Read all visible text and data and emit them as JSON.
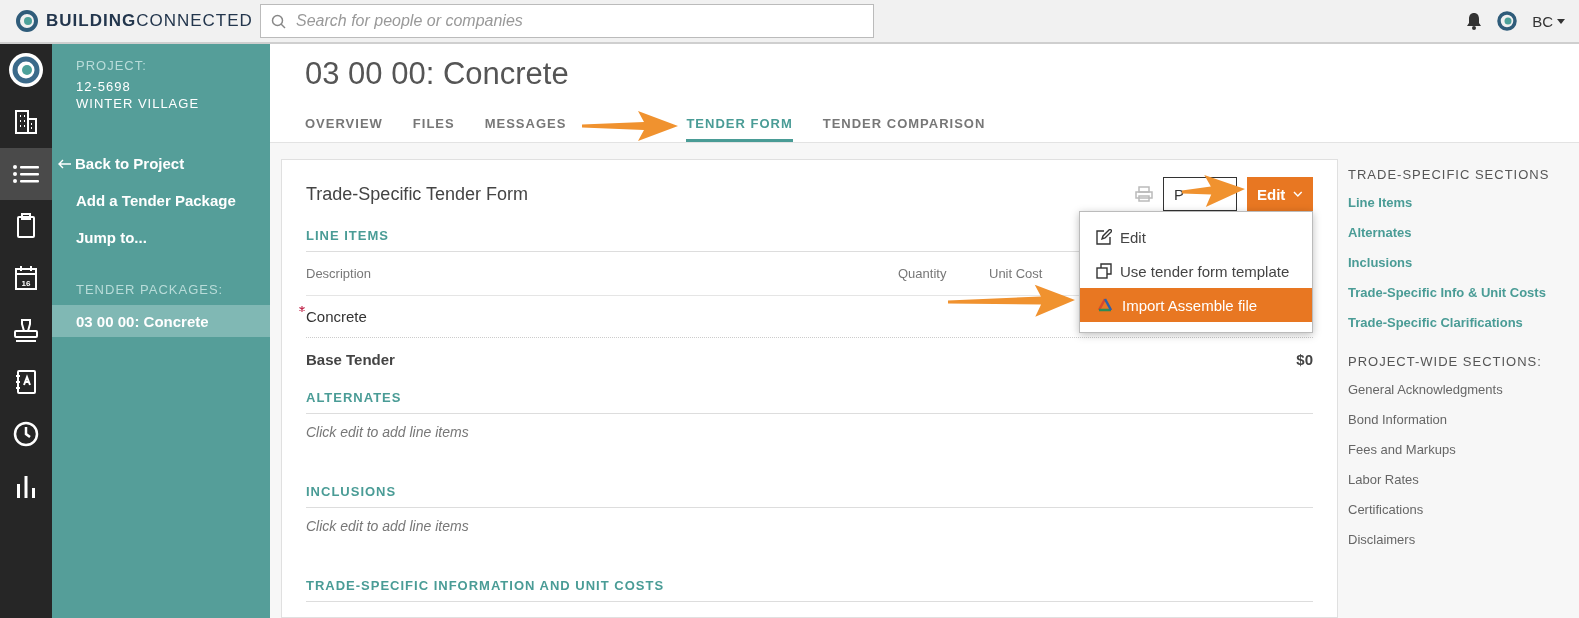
{
  "topbar": {
    "logo": {
      "bold": "BUILDING",
      "light": "CONNECTED"
    },
    "search": {
      "placeholder": "Search for people or companies"
    },
    "user": "BC"
  },
  "rail": [
    {
      "kind": "logo",
      "selected": false
    },
    {
      "kind": "building",
      "selected": false
    },
    {
      "kind": "list",
      "selected": true
    },
    {
      "kind": "clipboard",
      "selected": false
    },
    {
      "kind": "calendar",
      "selected": false,
      "label": "16"
    },
    {
      "kind": "stamp",
      "selected": false
    },
    {
      "kind": "book",
      "selected": false
    },
    {
      "kind": "clock",
      "selected": false
    },
    {
      "kind": "chart",
      "selected": false
    }
  ],
  "sidebar": {
    "project_label": "PROJECT:",
    "project_number": "12-5698",
    "project_name": "WINTER VILLAGE",
    "links": [
      {
        "label": "Back to Project",
        "back": true
      },
      {
        "label": "Add a Tender Package",
        "back": false
      },
      {
        "label": "Jump to...",
        "back": false
      }
    ],
    "packages_label": "TENDER PACKAGES:",
    "packages": [
      {
        "label": "03 00 00: Concrete",
        "selected": true
      }
    ]
  },
  "page": {
    "title": "03 00 00: Concrete",
    "tabs": [
      {
        "label": "OVERVIEW",
        "selected": false
      },
      {
        "label": "FILES",
        "selected": false
      },
      {
        "label": "MESSAGES",
        "selected": false
      },
      {
        "label": "TENDER FORM",
        "selected": true
      },
      {
        "label": "TENDER COMPARISON",
        "selected": false
      }
    ]
  },
  "form": {
    "title": "Trade-Specific Tender Form",
    "print_button": "P",
    "edit_button": "Edit",
    "menu": [
      {
        "kind": "edit",
        "label": "Edit",
        "selected": false
      },
      {
        "kind": "template",
        "label": "Use tender form template",
        "selected": false
      },
      {
        "kind": "assemble",
        "label": "Import Assemble file",
        "selected": true
      }
    ],
    "line_items": {
      "heading": "LINE ITEMS",
      "columns": [
        "Description",
        "Quantity",
        "Unit Cost"
      ],
      "rows": [
        {
          "description": "Concrete",
          "required": true
        }
      ],
      "total_label": "Base Tender",
      "total": "$0"
    },
    "sections": [
      {
        "heading": "ALTERNATES",
        "hint": "Click edit to add line items"
      },
      {
        "heading": "INCLUSIONS",
        "hint": "Click edit to add line items"
      },
      {
        "heading": "TRADE-SPECIFIC INFORMATION AND UNIT COSTS"
      }
    ]
  },
  "right_panel": {
    "groups": [
      {
        "heading": "TRADE-SPECIFIC SECTIONS",
        "kind": "link",
        "items": [
          "Line Items",
          "Alternates",
          "Inclusions",
          "Trade-Specific Info & Unit Costs",
          "Trade-Specific Clarifications"
        ]
      },
      {
        "heading": "PROJECT-WIDE SECTIONS:",
        "kind": "plain",
        "items": [
          "General Acknowledgments",
          "Bond Information",
          "Fees and Markups",
          "Labor Rates",
          "Certifications",
          "Disclaimers"
        ]
      }
    ]
  }
}
